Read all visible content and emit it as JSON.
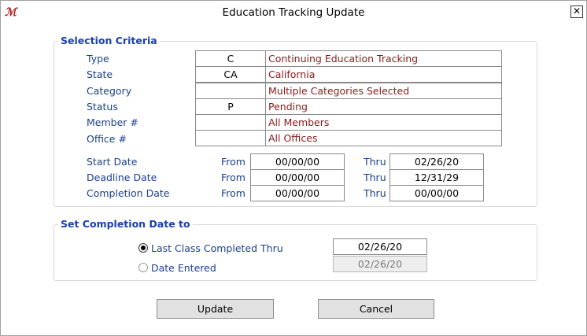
{
  "window": {
    "title": "Education Tracking Update",
    "close_label": "✕"
  },
  "selection": {
    "group_title": "Selection Criteria",
    "rows": [
      {
        "label": "Type",
        "code": "C",
        "desc": "Continuing Education Tracking"
      },
      {
        "label": "State",
        "code": "CA",
        "desc": "California"
      },
      {
        "label": "Category",
        "code": "",
        "desc": "Multiple Categories Selected"
      },
      {
        "label": "Status",
        "code": "P",
        "desc": "Pending"
      },
      {
        "label": "Member #",
        "code": "",
        "desc": "All Members"
      },
      {
        "label": "Office #",
        "code": "",
        "desc": "All Offices"
      }
    ],
    "from_label": "From",
    "thru_label": "Thru",
    "dates": [
      {
        "label": "Start Date",
        "from": "00/00/00",
        "thru": "02/26/20"
      },
      {
        "label": "Deadline Date",
        "from": "00/00/00",
        "thru": "12/31/29"
      },
      {
        "label": "Completion Date",
        "from": "00/00/00",
        "thru": "00/00/00"
      }
    ]
  },
  "completion": {
    "group_title": "Set Completion Date to",
    "options": [
      {
        "label": "Last Class Completed Thru",
        "selected": true,
        "date": "02/26/20",
        "enabled": true
      },
      {
        "label": "Date Entered",
        "selected": false,
        "date": "02/26/20",
        "enabled": false
      }
    ]
  },
  "buttons": {
    "update": "Update",
    "cancel": "Cancel"
  }
}
